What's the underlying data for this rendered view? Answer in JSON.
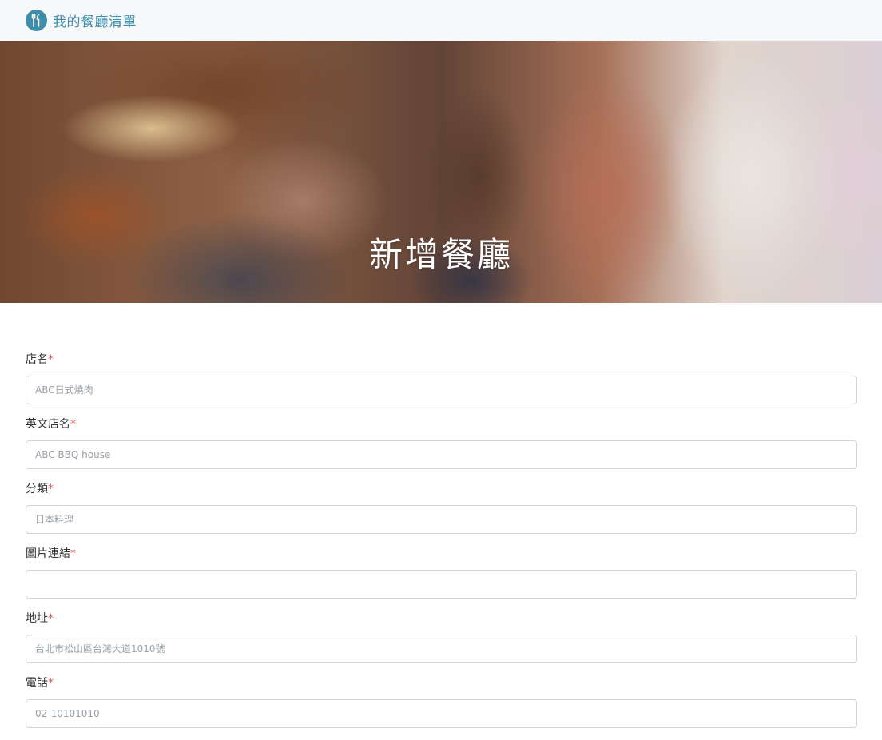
{
  "navbar": {
    "brand_icon": "utensils-icon",
    "brand_title": "我的餐廳清單",
    "brand_color": "#3e8eaa"
  },
  "banner": {
    "title": "新增餐廳"
  },
  "form": {
    "required_mark": "*",
    "fields": [
      {
        "label": "店名",
        "placeholder": "ABC日式燒肉",
        "value": ""
      },
      {
        "label": "英文店名",
        "placeholder": "ABC BBQ house",
        "value": ""
      },
      {
        "label": "分類",
        "placeholder": "日本料理",
        "value": ""
      },
      {
        "label": "圖片連結",
        "placeholder": "",
        "value": ""
      },
      {
        "label": "地址",
        "placeholder": "台北市松山區台灣大道1010號",
        "value": ""
      },
      {
        "label": "電話",
        "placeholder": "02-10101010",
        "value": ""
      }
    ]
  }
}
